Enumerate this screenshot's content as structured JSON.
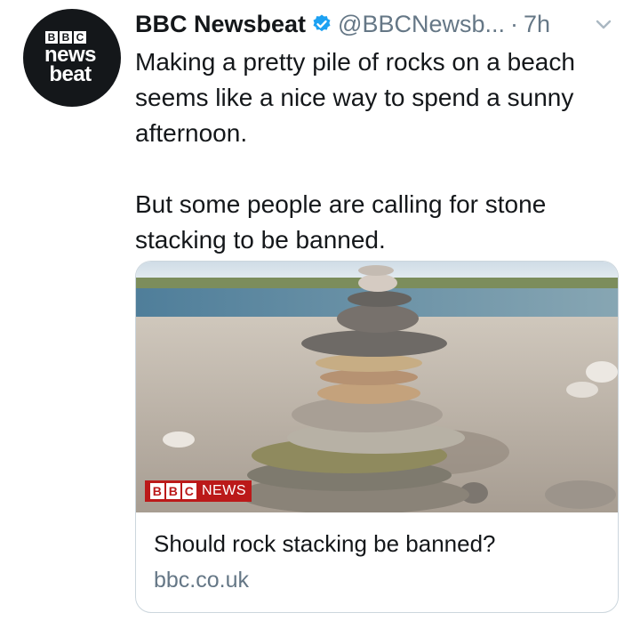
{
  "avatar": {
    "blocks": [
      "B",
      "B",
      "C"
    ],
    "line1": "news",
    "line2": "beat"
  },
  "header": {
    "name": "BBC Newsbeat",
    "handle": "@BBCNewsb...",
    "separator": "·",
    "time": "7h"
  },
  "tweet": {
    "paragraph1": "Making a pretty pile of rocks on a beach seems like a nice way to spend a sunny afternoon.",
    "paragraph2": "But some people are calling for stone stacking to be banned."
  },
  "card": {
    "badge_blocks": [
      "B",
      "B",
      "C"
    ],
    "badge_text": "NEWS",
    "title": "Should rock stacking be banned?",
    "domain": "bbc.co.uk"
  },
  "colors": {
    "text": "#14171a",
    "secondary": "#657786",
    "verified": "#1da1f2",
    "border": "#ccd6dd",
    "bbc_red": "#bb1919"
  },
  "icons": [
    "verified-badge-icon",
    "chevron-down-icon"
  ]
}
